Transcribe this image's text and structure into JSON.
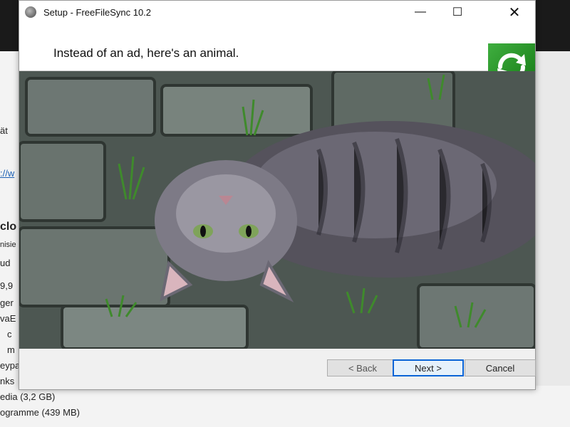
{
  "window": {
    "title": "Setup - FreeFileSync 10.2",
    "controls": {
      "minimize": "—",
      "maximize": "☐",
      "close": "✕"
    }
  },
  "header": {
    "text": "Instead of an ad, here's an animal.",
    "logo_icon": "freefilesync-sync-arrows-icon"
  },
  "photo": {
    "subject": "cat lying upside down on stone pavement"
  },
  "buttons": {
    "back": "< Back",
    "next": "Next >",
    "cancel": "Cancel"
  },
  "background_window": {
    "fragments": [
      "ät",
      "://w",
      "clo",
      "nisie",
      "ud",
      "9,9",
      "ger",
      "vaE",
      "c",
      "m",
      "eypa",
      "nks",
      "edia (3,2 GB)",
      "ogramme (439 MB)"
    ]
  },
  "colors": {
    "logo_green": "#2e9a2e",
    "focus_blue": "#0a64d6"
  }
}
